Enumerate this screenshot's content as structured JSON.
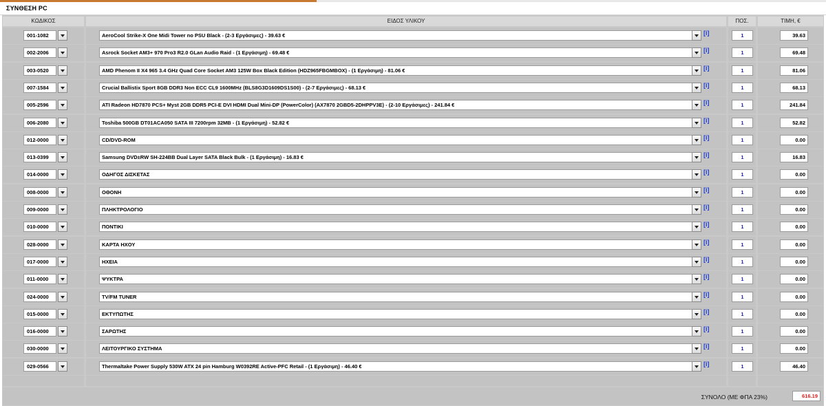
{
  "title": "ΣΥΝΘΕΣΗ PC",
  "headers": {
    "code": "ΚΩΔΙΚΟΣ",
    "desc": "ΕΙΔΟΣ ΥΛΙΚΟΥ",
    "qty": "ΠΟΣ.",
    "price": "ΤΙΜΗ, €"
  },
  "info_label": "[i]",
  "rows": [
    {
      "code": "001-1082",
      "desc": "AeroCool Strike-X One Midi Tower no PSU Black - (2-3 Εργάσιμες) - 39.63 €",
      "qty": "1",
      "price": "39.63"
    },
    {
      "code": "002-2006",
      "desc": "Asrock Socket AM3+ 970 Pro3 R2.0 GLan Audio Raid - (1 Εργάσιμη) - 69.48 €",
      "qty": "1",
      "price": "69.48"
    },
    {
      "code": "003-0520",
      "desc": "AMD Phenom II X4 965 3.4 GHz Quad Core Socket AM3 125W Box Black Edition (HDZ965FBGMBOX) - (1 Εργάσιμη) - 81.06 €",
      "qty": "1",
      "price": "81.06"
    },
    {
      "code": "007-1584",
      "desc": "Crucial Ballistix Sport 8GB DDR3 Non ECC CL9 1600MHz (BLS8G3D1609DS1S00) - (2-7 Εργάσιμες) - 68.13 €",
      "qty": "1",
      "price": "68.13"
    },
    {
      "code": "005-2596",
      "desc": "ATI Radeon HD7870 PCS+ Myst 2GB DDR5 PCI-E DVI HDMI Dual Mini-DP (PowerColor) (AX7870 2GBD5-2DHPPV3E) - (2-10 Εργάσιμες) - 241.84 €",
      "qty": "1",
      "price": "241.84"
    },
    {
      "code": "006-2080",
      "desc": "Toshiba 500GB DT01ACA050 SATA III 7200rpm 32MB - (1 Εργάσιμη) - 52.82 €",
      "qty": "1",
      "price": "52.82"
    },
    {
      "code": "012-0000",
      "desc": "CD/DVD-ROM",
      "qty": "1",
      "price": "0.00"
    },
    {
      "code": "013-0399",
      "desc": "Samsung DVD±RW SH-224BB Dual Layer SATA Black Bulk - (1 Εργάσιμη) - 16.83 €",
      "qty": "1",
      "price": "16.83"
    },
    {
      "code": "014-0000",
      "desc": "ΟΔΗΓΟΣ ΔΙΣΚΕΤΑΣ",
      "qty": "1",
      "price": "0.00"
    },
    {
      "code": "008-0000",
      "desc": "ΟΘΟΝΗ",
      "qty": "1",
      "price": "0.00"
    },
    {
      "code": "009-0000",
      "desc": "ΠΛΗΚΤΡΟΛΟΓΙΟ",
      "qty": "1",
      "price": "0.00"
    },
    {
      "code": "010-0000",
      "desc": "ΠΟΝΤΙΚΙ",
      "qty": "1",
      "price": "0.00"
    },
    {
      "code": "028-0000",
      "desc": "ΚΑΡΤΑ ΗΧΟΥ",
      "qty": "1",
      "price": "0.00"
    },
    {
      "code": "017-0000",
      "desc": "ΗΧΕΙΑ",
      "qty": "1",
      "price": "0.00"
    },
    {
      "code": "011-0000",
      "desc": "ΨΥΚΤΡΑ",
      "qty": "1",
      "price": "0.00"
    },
    {
      "code": "024-0000",
      "desc": "TV/FM TUNER",
      "qty": "1",
      "price": "0.00"
    },
    {
      "code": "015-0000",
      "desc": "ΕΚΤΥΠΩΤΗΣ",
      "qty": "1",
      "price": "0.00"
    },
    {
      "code": "016-0000",
      "desc": "ΣΑΡΩΤΗΣ",
      "qty": "1",
      "price": "0.00"
    },
    {
      "code": "030-0000",
      "desc": "ΛΕΙΤΟΥΡΓΙΚΟ ΣΥΣΤΗΜΑ",
      "qty": "1",
      "price": "0.00"
    },
    {
      "code": "029-0566",
      "desc": "Thermaltake Power Supply 530W ATX 24 pin Hamburg W0392RE Active-PFC Retail - (1 Εργάσιμη) - 46.40 €",
      "qty": "1",
      "price": "46.40"
    }
  ],
  "total": {
    "label": "ΣΥΝΟΛΟ (ΜΕ ΦΠΑ 23%)",
    "value": "616.19"
  },
  "colors": {
    "accent": "#c97a32",
    "panel": "#c9c9c9",
    "info_link": "#1f3fd6",
    "qty_text": "#1a1aa6",
    "total_text": "#e01b1b"
  }
}
